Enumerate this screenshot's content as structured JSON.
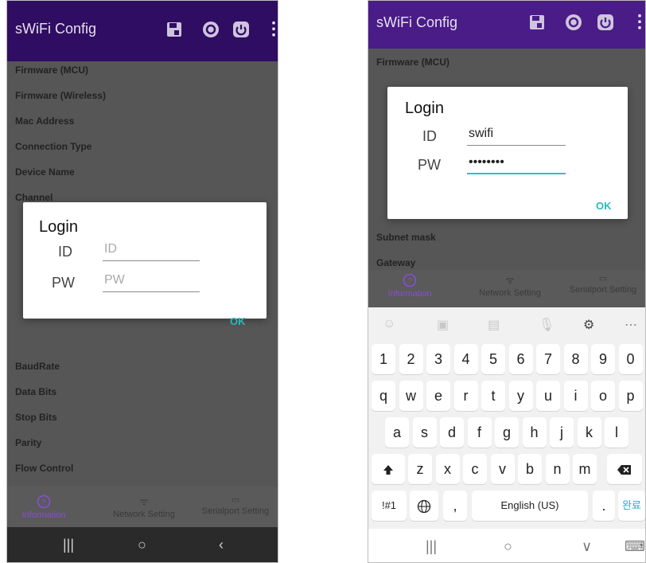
{
  "app": {
    "title": "sWiFi Config",
    "icons": [
      "save-icon",
      "refresh-icon",
      "power-icon",
      "more-vert-icon"
    ]
  },
  "left": {
    "info_items": [
      "Firmware (MCU)",
      "Firmware (Wireless)",
      "Mac Address",
      "Connection Type",
      "Device Name",
      "Channel"
    ],
    "info_items_lower": [
      "BaudRate",
      "Data Bits",
      "Stop Bits",
      "Parity",
      "Flow Control"
    ],
    "login": {
      "title": "Login",
      "id_label": "ID",
      "pw_label": "PW",
      "id_placeholder": "ID",
      "pw_placeholder": "PW",
      "ok": "OK"
    },
    "nav": [
      "Information",
      "Network Setting",
      "Serialport Setting"
    ],
    "sysnav": [
      "|||",
      "○",
      "‹"
    ]
  },
  "right": {
    "info_items": [
      "Firmware (MCU)",
      "Subnet mask",
      "Gateway"
    ],
    "login": {
      "title": "Login",
      "id_label": "ID",
      "pw_label": "PW",
      "id_value": "swifi",
      "pw_value": "••••••••",
      "ok": "OK"
    },
    "nav": [
      "Information",
      "Network Setting",
      "Serialport Setting"
    ],
    "keyboard": {
      "row1": [
        "1",
        "2",
        "3",
        "4",
        "5",
        "6",
        "7",
        "8",
        "9",
        "0"
      ],
      "row2": [
        "q",
        "w",
        "e",
        "r",
        "t",
        "y",
        "u",
        "i",
        "o",
        "p"
      ],
      "row3": [
        "a",
        "s",
        "d",
        "f",
        "g",
        "h",
        "j",
        "k",
        "l"
      ],
      "row4": [
        "z",
        "x",
        "c",
        "v",
        "b",
        "n",
        "m"
      ],
      "symbols": "!#1",
      "comma": ",",
      "space": "English (US)",
      "period": ".",
      "done": "완료"
    },
    "sysnav": [
      "|||",
      "○",
      "∨",
      "⌨"
    ]
  },
  "colors": {
    "appbar": "#3f0a7e",
    "accent": "#26bdb9",
    "active_tab": "#8a4dd6"
  }
}
